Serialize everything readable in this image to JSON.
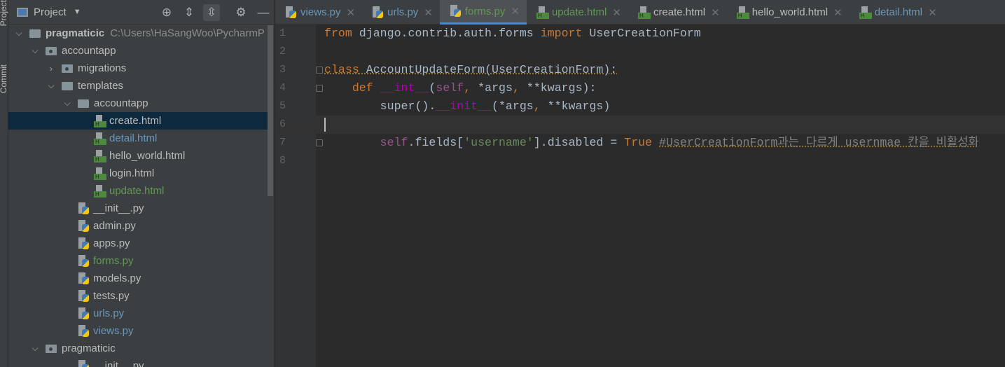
{
  "toolstrip": {
    "project": "Project",
    "commit": "Commit"
  },
  "sidebar": {
    "title": "Project",
    "tree": [
      {
        "label": "pragmaticic",
        "path": "C:\\Users\\HaSangWoo\\PycharmP",
        "depth": 0,
        "kind": "folder",
        "open": true,
        "bold": true
      },
      {
        "label": "accountapp",
        "depth": 1,
        "kind": "pkg",
        "open": true
      },
      {
        "label": "migrations",
        "depth": 2,
        "kind": "pkg",
        "open": false
      },
      {
        "label": "templates",
        "depth": 2,
        "kind": "folder",
        "open": true
      },
      {
        "label": "accountapp",
        "depth": 3,
        "kind": "folder",
        "open": true
      },
      {
        "label": "create.html",
        "depth": 4,
        "kind": "html",
        "selected": true
      },
      {
        "label": "detail.html",
        "depth": 4,
        "kind": "html",
        "status": "b"
      },
      {
        "label": "hello_world.html",
        "depth": 4,
        "kind": "html"
      },
      {
        "label": "login.html",
        "depth": 4,
        "kind": "html"
      },
      {
        "label": "update.html",
        "depth": 4,
        "kind": "html",
        "status": "g"
      },
      {
        "label": "__init__.py",
        "depth": 3,
        "kind": "py"
      },
      {
        "label": "admin.py",
        "depth": 3,
        "kind": "py"
      },
      {
        "label": "apps.py",
        "depth": 3,
        "kind": "py"
      },
      {
        "label": "forms.py",
        "depth": 3,
        "kind": "py",
        "status": "g"
      },
      {
        "label": "models.py",
        "depth": 3,
        "kind": "py"
      },
      {
        "label": "tests.py",
        "depth": 3,
        "kind": "py"
      },
      {
        "label": "urls.py",
        "depth": 3,
        "kind": "py",
        "status": "b"
      },
      {
        "label": "views.py",
        "depth": 3,
        "kind": "py",
        "status": "b"
      },
      {
        "label": "pragmaticic",
        "depth": 1,
        "kind": "pkg",
        "open": true
      },
      {
        "label": "__init__.py",
        "depth": 3,
        "kind": "py"
      }
    ]
  },
  "tabs": [
    {
      "label": "views.py",
      "kind": "py",
      "status": "b"
    },
    {
      "label": "urls.py",
      "kind": "py",
      "status": "b"
    },
    {
      "label": "forms.py",
      "kind": "py",
      "status": "g",
      "active": true
    },
    {
      "label": "update.html",
      "kind": "html",
      "status": "g"
    },
    {
      "label": "create.html",
      "kind": "html"
    },
    {
      "label": "hello_world.html",
      "kind": "html"
    },
    {
      "label": "detail.html",
      "kind": "html",
      "status": "b"
    }
  ],
  "editor": {
    "current_line": 6,
    "lines": [
      {
        "n": "1",
        "tokens": [
          [
            "from",
            "kw"
          ],
          [
            " django.contrib.auth.forms ",
            ""
          ],
          [
            "import",
            "kw"
          ],
          [
            " UserCreationForm",
            ""
          ]
        ]
      },
      {
        "n": "2",
        "tokens": []
      },
      {
        "n": "3",
        "tokens": [
          [
            "class",
            "kw wv"
          ],
          [
            " AccountUpdateForm(UserCreationForm):",
            "wv"
          ]
        ]
      },
      {
        "n": "4",
        "tokens": [
          [
            "    ",
            ""
          ],
          [
            "def",
            "kw"
          ],
          [
            " ",
            ""
          ],
          [
            "__int__",
            "mg"
          ],
          [
            "(",
            ""
          ],
          [
            "self",
            "sf"
          ],
          [
            ", ",
            "kw"
          ],
          [
            "*args",
            ""
          ],
          [
            ", ",
            "kw"
          ],
          [
            "**kwargs):",
            ""
          ]
        ]
      },
      {
        "n": "5",
        "tokens": [
          [
            "        super().",
            ""
          ],
          [
            "__init__",
            "mg"
          ],
          [
            "(*args",
            ""
          ],
          [
            ", ",
            "kw"
          ],
          [
            "**kwargs)",
            ""
          ]
        ]
      },
      {
        "n": "6",
        "tokens": []
      },
      {
        "n": "7",
        "tokens": [
          [
            "        ",
            ""
          ],
          [
            "self",
            "sf"
          ],
          [
            ".fields[",
            ""
          ],
          [
            "'username'",
            "st"
          ],
          [
            "].disabled = ",
            ""
          ],
          [
            "True",
            "kw"
          ],
          [
            " ",
            ""
          ],
          [
            "#UserCreationForm과는 다르게 usernmae 칸을 비활성화",
            "cm"
          ]
        ]
      },
      {
        "n": "8",
        "tokens": []
      }
    ]
  }
}
